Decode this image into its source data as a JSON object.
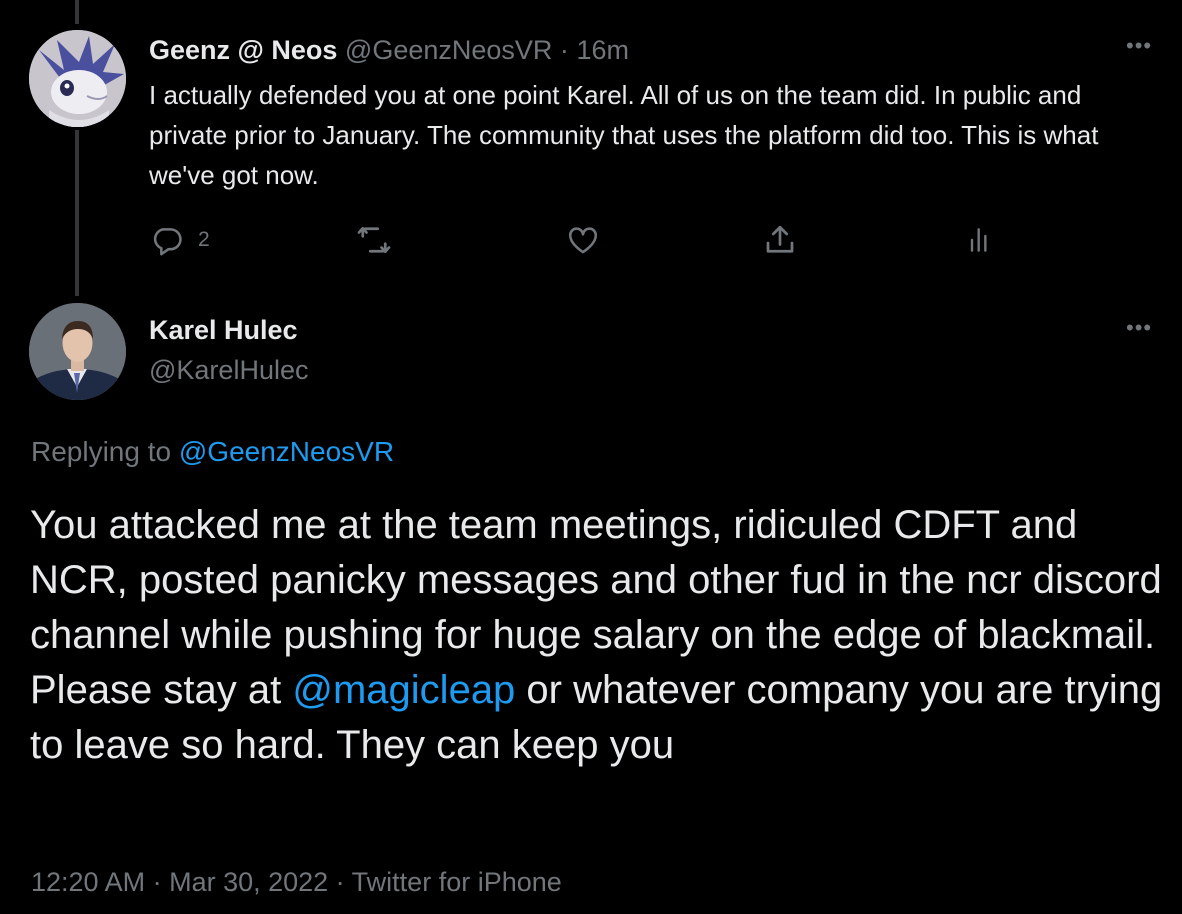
{
  "thread": {
    "tweet1": {
      "display_name": "Geenz @ Neos",
      "handle": "@GeenzNeosVR",
      "separator": "·",
      "time": "16m",
      "more": "•••",
      "text": "I actually defended you at one point Karel.  All of us on the team did.  In public and private prior to January.  The community that uses the platform did too.  This is what we've got now.",
      "actions": {
        "reply_count": "2"
      }
    },
    "tweet2": {
      "display_name": "Karel Hulec",
      "handle": "@KarelHulec",
      "more": "•••",
      "replying_prefix": "Replying to",
      "replying_handle": "@GeenzNeosVR",
      "text_part1": "You attacked me at the team meetings, ridiculed CDFT and NCR, posted panicky messages and other fud in the ncr discord channel while pushing for huge salary on the edge of blackmail. Please stay at ",
      "mention": "@magicleap",
      "text_part2": " or whatever company you are trying to leave so hard. They can keep you",
      "timestamp": "12:20 AM · Mar 30, 2022 · Twitter for iPhone"
    }
  },
  "colors": {
    "background": "#000000",
    "primary_text": "#e7e9ea",
    "secondary_text": "#71767b",
    "link": "#1d9bf0",
    "thread_line": "#333639"
  },
  "icons": [
    "reply-icon",
    "retweet-icon",
    "like-icon",
    "share-icon",
    "analytics-icon",
    "more-icon"
  ]
}
